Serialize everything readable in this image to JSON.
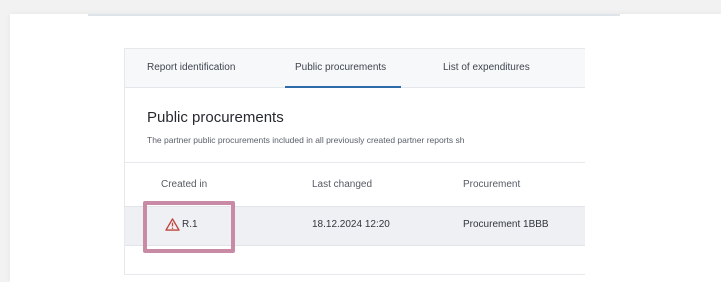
{
  "tabs": [
    {
      "label": "Report identification"
    },
    {
      "label": "Public procurements",
      "active": true
    },
    {
      "label": "List of expenditures"
    }
  ],
  "section": {
    "title": "Public procurements",
    "description": "The partner public procurements included in all previously created partner reports sh"
  },
  "table": {
    "headers": [
      "Created in",
      "Last changed",
      "Procurement"
    ],
    "rows": [
      {
        "created_in": "R.1",
        "last_changed": "18.12.2024 12:20",
        "procurement": "Procurement 1BBB",
        "warning_icon": "warning-triangle-icon"
      }
    ]
  },
  "colors": {
    "active_tab_underline": "#2c6aa8",
    "warning_icon": "#c0453c",
    "highlight_box": "#c98aa5",
    "row_background": "#eef0f4"
  }
}
